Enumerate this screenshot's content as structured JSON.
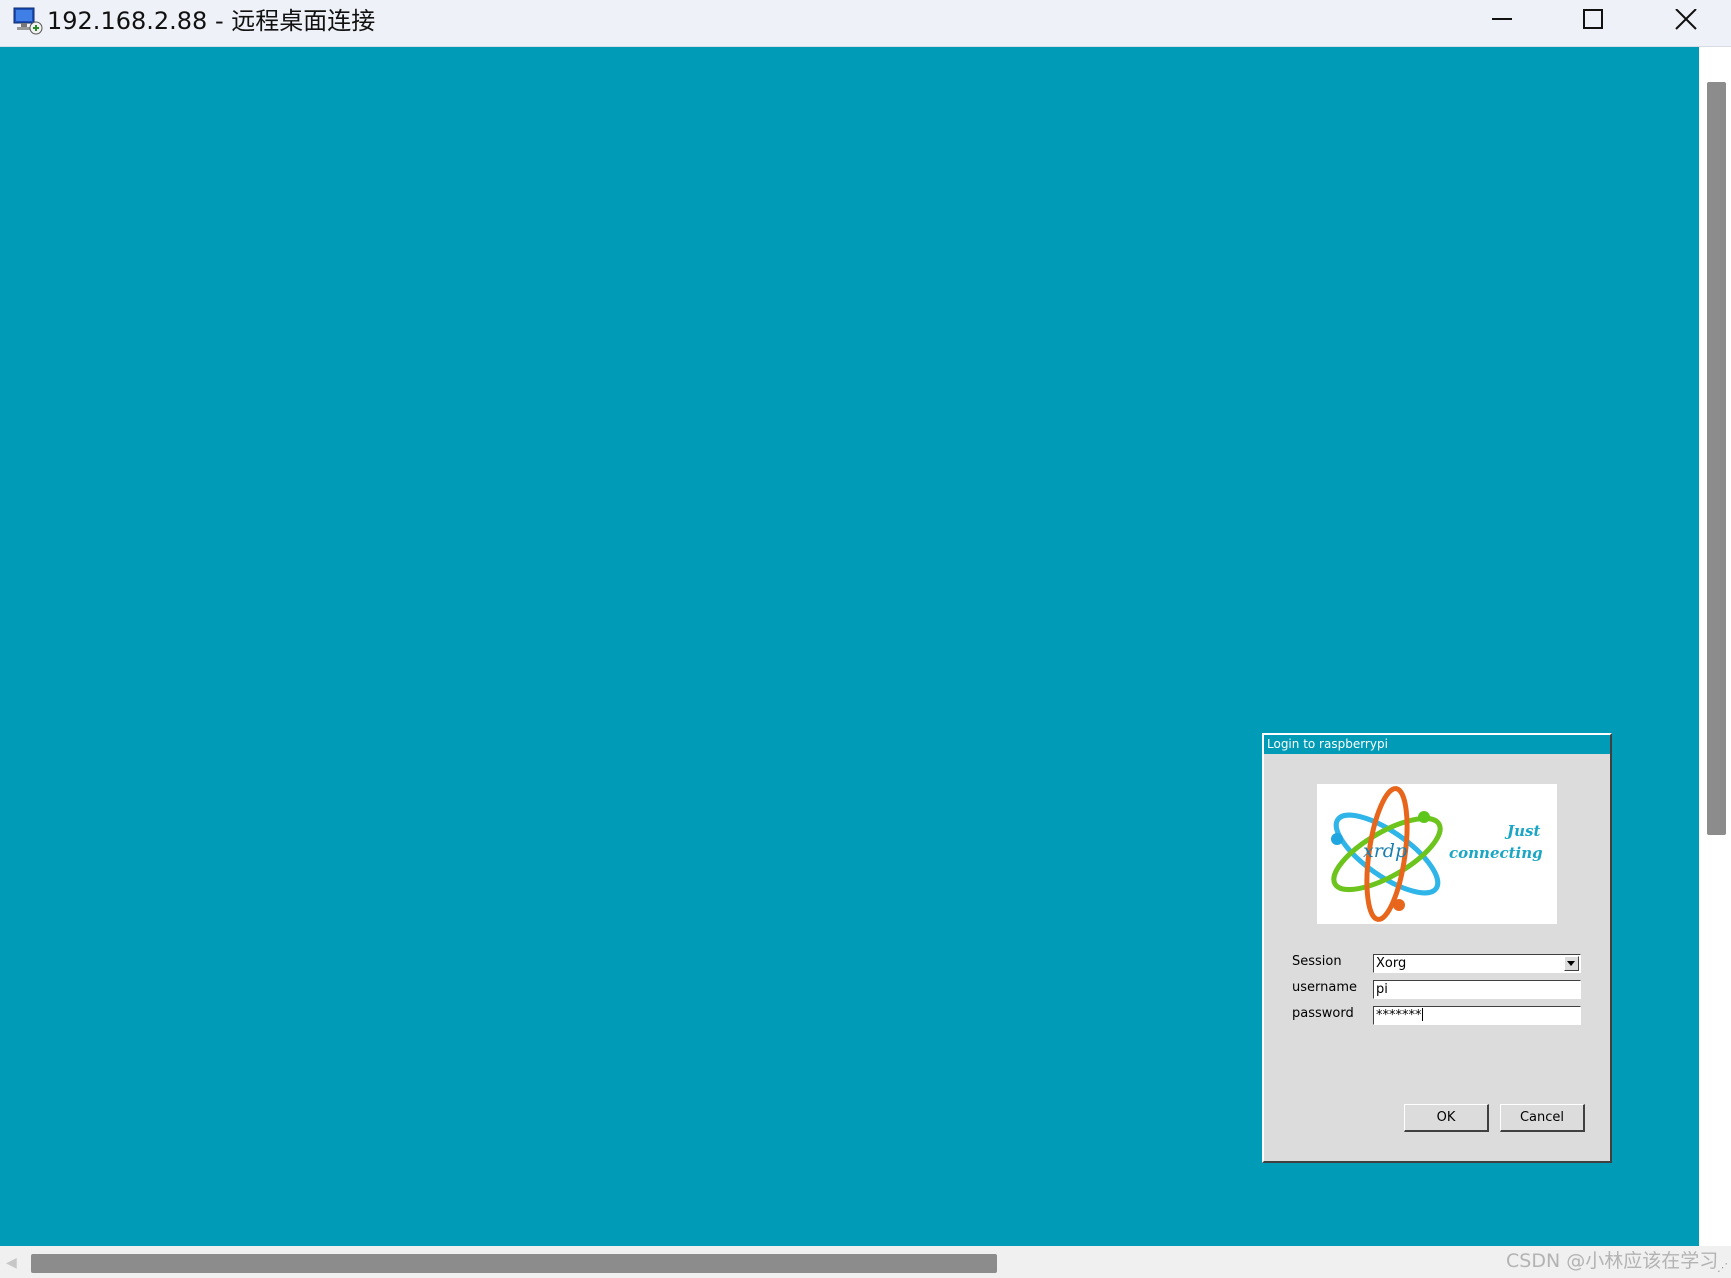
{
  "window": {
    "title": "192.168.2.88 - 远程桌面连接",
    "icon": "remote-desktop-icon",
    "controls": [
      "minimize-icon",
      "maximize-icon",
      "close-icon"
    ]
  },
  "desktop": {
    "background_color": "#009bb6"
  },
  "dialog": {
    "title": "Login to raspberrypi",
    "logo": {
      "name": "xrdp",
      "tagline_1": "Just",
      "tagline_2": "connecting"
    },
    "session_label": "Session",
    "session_value": "Xorg",
    "username_label": "username",
    "username_value": "pi",
    "password_label": "password",
    "password_value": "*******",
    "ok_label": "OK",
    "cancel_label": "Cancel"
  },
  "watermark": "CSDN @小林应该在学习"
}
